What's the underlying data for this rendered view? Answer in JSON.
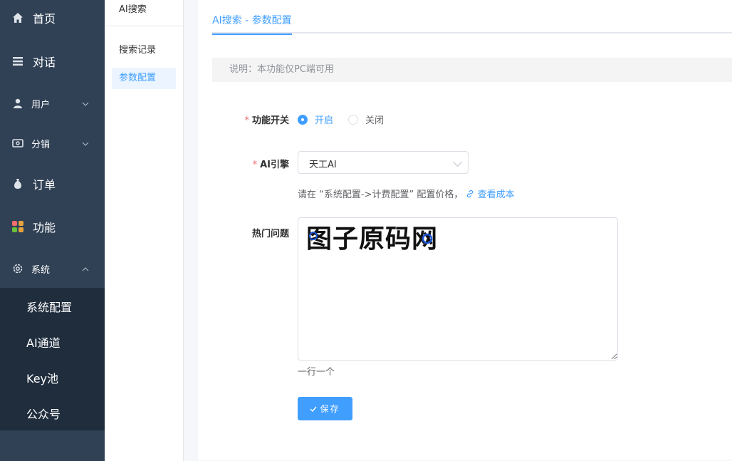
{
  "sidebar": {
    "items": [
      {
        "label": "首页",
        "icon": "home-icon"
      },
      {
        "label": "对话",
        "icon": "list-icon"
      },
      {
        "label": "用户",
        "icon": "user-icon"
      },
      {
        "label": "分销",
        "icon": "wallet-icon"
      },
      {
        "label": "订单",
        "icon": "money-bag-icon"
      },
      {
        "label": "功能",
        "icon": "apps-icon"
      },
      {
        "label": "系统",
        "icon": "gear-icon"
      }
    ],
    "submenu": [
      "系统配置",
      "AI通道",
      "Key池",
      "公众号"
    ]
  },
  "panel2": {
    "title": "AI搜索",
    "items": [
      "搜索记录",
      "参数配置"
    ]
  },
  "main": {
    "tab": "AI搜索 - 参数配置",
    "notice": "说明：本功能仅PC端可用",
    "form": {
      "switch_label": "功能开关",
      "switch_on": "开启",
      "switch_off": "关闭",
      "engine_label": "AI引擎",
      "engine_value": "天工AI",
      "hint_prefix": "请在 “系统配置->计费配置” 配置价格，",
      "hint_link": "查看成本",
      "hot_label": "热门问题",
      "hot_value": "",
      "hot_hint": "一行一个",
      "save": "保存"
    }
  },
  "watermark": {
    "text": "图子原码网"
  },
  "colors": {
    "sidebar": "#304156",
    "submenu": "#1f2d3d",
    "primary": "#409eff",
    "required": "#f56c6c"
  }
}
